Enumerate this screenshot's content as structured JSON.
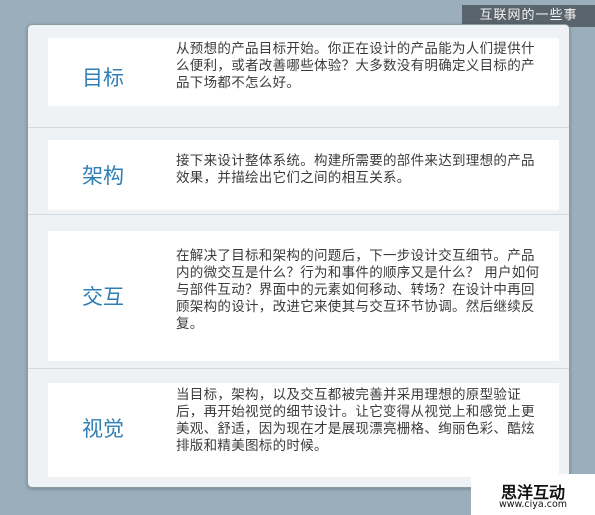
{
  "banner": "互联网的一些事",
  "sections": [
    {
      "title": "目标",
      "text": "从预想的产品目标开始。你正在设计的产品能为人们提供什么便利，或者改善哪些体验？大多数没有明确定义目标的产品下场都不怎么好。"
    },
    {
      "title": "架构",
      "text": "接下来设计整体系统。构建所需要的部件来达到理想的产品效果，并描绘出它们之间的相互关系。"
    },
    {
      "title": "交互",
      "text": "在解决了目标和架构的问题后，下一步设计交互细节。产品内的微交互是什么？行为和事件的顺序又是什么？ 用户如何与部件互动？界面中的元素如何移动、转场？在设计中再回顾架构的设计，改进它来使其与交互环节协调。然后继续反复。"
    },
    {
      "title": "视觉",
      "text": "当目标，架构，以及交互都被完善并采用理想的原型验证后，再开始视觉的细节设计。让它变得从视觉上和感觉上更美观、舒适，因为现在才是展现漂亮栅格、绚丽色彩、酷炫排版和精美图标的时候。"
    }
  ],
  "logo": {
    "name": "思洋互动",
    "url": "www.ciya.com"
  }
}
